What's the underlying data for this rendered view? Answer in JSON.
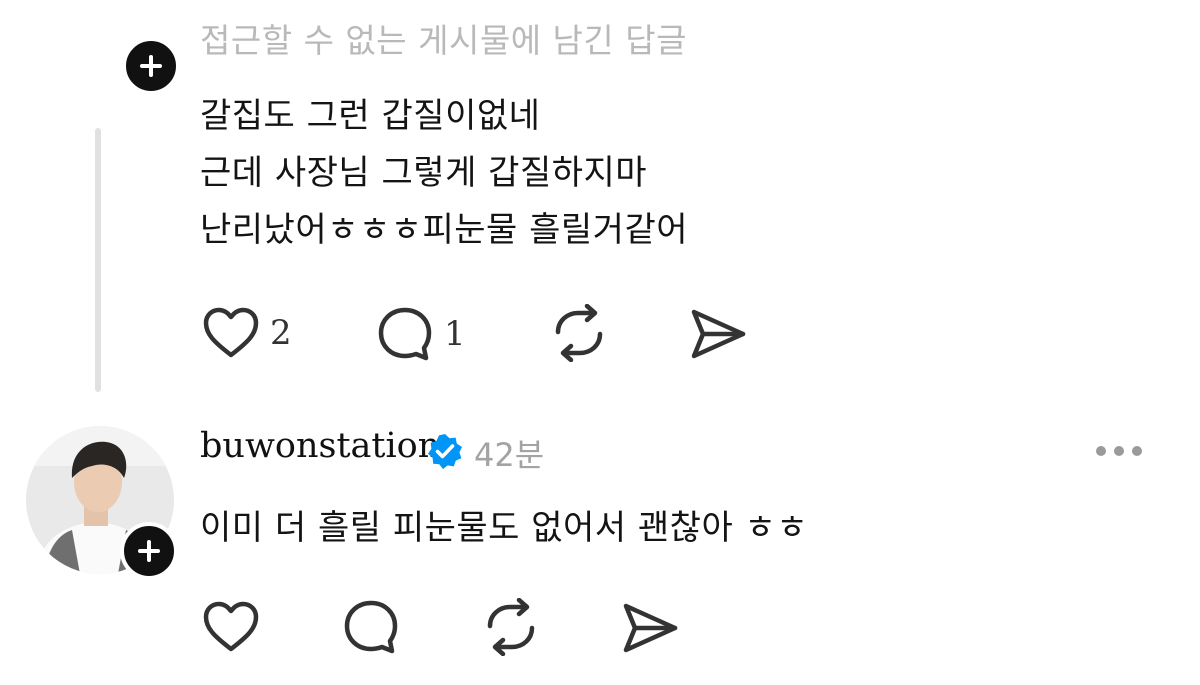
{
  "first_post": {
    "header": "접근할 수 없는 게시물에 남긴 답글",
    "lines": [
      "갈집도 그런 갑질이없네",
      "근데 사장님 그렇게 갑질하지마",
      "난리났어ㅎㅎㅎ피눈물 흘릴거같어"
    ],
    "likes": "2",
    "replies": "1"
  },
  "reply": {
    "username": "buwonstation",
    "time": "42분",
    "text": "이미 더 흘릴 피눈물도 없어서 괜찮아 ㅎㅎ"
  },
  "colors": {
    "text": "#141414",
    "muted": "#b9b9b9",
    "verified": "#0095f6",
    "icon": "#333333"
  },
  "icons": [
    "plus-icon",
    "heart-icon",
    "comment-icon",
    "repost-icon",
    "share-icon",
    "verified-icon",
    "more-icon"
  ]
}
